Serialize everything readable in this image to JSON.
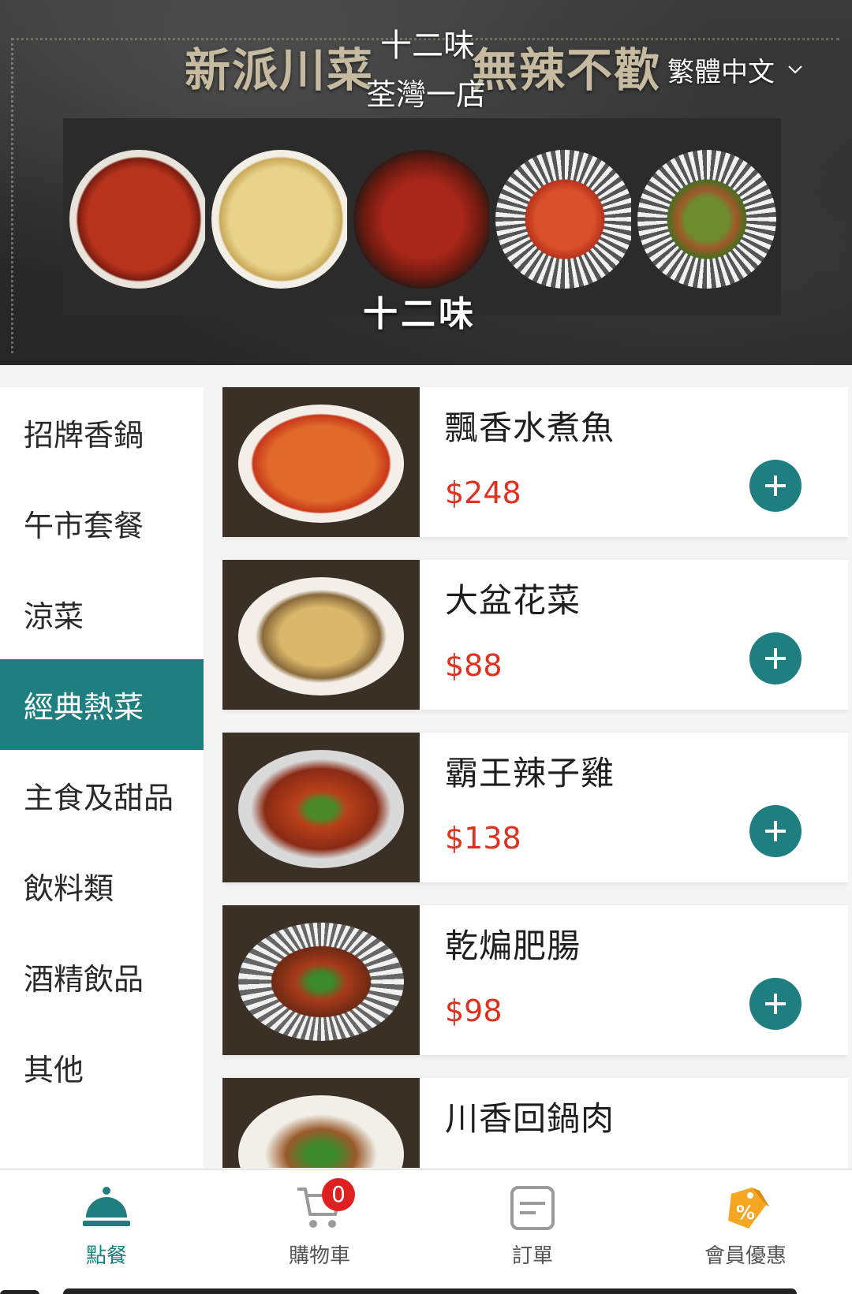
{
  "banner": {
    "slogan_left": "新派川菜",
    "slogan_right": "無辣不歡",
    "store_name": "十二味",
    "store_branch": "荃灣一店",
    "language": "繁體中文",
    "logo_text": "十二味"
  },
  "categories": [
    {
      "label": "招牌香鍋"
    },
    {
      "label": "午市套餐"
    },
    {
      "label": "涼菜"
    },
    {
      "label": "經典熱菜"
    },
    {
      "label": "主食及甜品"
    },
    {
      "label": "飲料類"
    },
    {
      "label": "酒精飲品"
    },
    {
      "label": "其他"
    }
  ],
  "active_category": "經典熱菜",
  "menu_items": [
    {
      "name": "飄香水煮魚",
      "price": "$248"
    },
    {
      "name": "大盆花菜",
      "price": "$88"
    },
    {
      "name": "霸王辣子雞",
      "price": "$138"
    },
    {
      "name": "乾煸肥腸",
      "price": "$98"
    },
    {
      "name": "川香回鍋肉",
      "price": ""
    }
  ],
  "bottom_nav": [
    {
      "label": "點餐",
      "icon": "cloche-icon",
      "active": true
    },
    {
      "label": "購物車",
      "icon": "cart-icon",
      "active": false
    },
    {
      "label": "訂單",
      "icon": "order-icon",
      "active": false
    },
    {
      "label": "會員優惠",
      "icon": "discount-tag-icon",
      "active": false
    }
  ],
  "cart_count": "0",
  "colors": {
    "accent": "#1f7f80",
    "price": "#e0301e",
    "badge": "#e02020",
    "discount_icon": "#f5a623"
  }
}
